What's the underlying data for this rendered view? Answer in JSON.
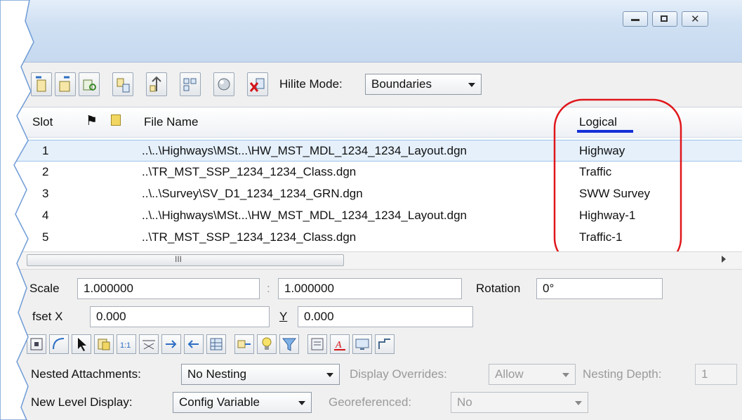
{
  "window": {
    "buttons": {
      "minimize": "minimize",
      "restore": "restore",
      "close": "close"
    }
  },
  "toolbar": {
    "icons": [
      "attach-icon",
      "detach-icon",
      "reload-icon",
      "swap-icon",
      "tree-icon",
      "grid-icon",
      "sphere-icon",
      "delete-icon"
    ],
    "hilite_label": "Hilite Mode:",
    "hilite_value": "Boundaries"
  },
  "grid": {
    "columns": {
      "slot": "Slot",
      "file_name": "File Name",
      "logical": "Logical"
    },
    "rows": [
      {
        "slot": "1",
        "file_name": "..\\..\\Highways\\MSt...\\HW_MST_MDL_1234_1234_Layout.dgn",
        "logical": "Highway"
      },
      {
        "slot": "2",
        "file_name": "..\\TR_MST_SSP_1234_1234_Class.dgn",
        "logical": "Traffic"
      },
      {
        "slot": "3",
        "file_name": "..\\..\\Survey\\SV_D1_1234_1234_GRN.dgn",
        "logical": "SWW Survey"
      },
      {
        "slot": "4",
        "file_name": "..\\..\\Highways\\MSt...\\HW_MST_MDL_1234_1234_Layout.dgn",
        "logical": "Highway-1"
      },
      {
        "slot": "5",
        "file_name": "..\\TR_MST_SSP_1234_1234_Class.dgn",
        "logical": "Traffic-1"
      }
    ],
    "scroll_grip": "III"
  },
  "props": {
    "scale_label": "Scale",
    "scale_value_1": "1.000000",
    "scale_sep": ":",
    "scale_value_2": "1.000000",
    "rotation_label": "Rotation",
    "rotation_value": "0°",
    "offset_x_label": "fset X",
    "offset_x_value": "0.000",
    "offset_y_label": "Y",
    "offset_y_value": "0.000"
  },
  "tools2": {
    "icons": [
      "fit-icon",
      "clip-icon",
      "select-icon",
      "copy-icon",
      "scale-icon",
      "frame-icon",
      "move-icon",
      "arrow-icon",
      "table-icon",
      "link-icon",
      "bulb-icon",
      "filter-icon",
      "props-icon",
      "text-color-icon",
      "monitor-icon",
      "path-icon"
    ]
  },
  "nesting": {
    "nested_label": "Nested Attachments:",
    "nested_value": "No Nesting",
    "overrides_label": "Display Overrides:",
    "overrides_value": "Allow",
    "depth_label": "Nesting Depth:",
    "depth_value": "1"
  },
  "levels": {
    "new_level_label": "New Level Display:",
    "new_level_value": "Config Variable",
    "geo_label": "Georeferenced:",
    "geo_value": "No"
  },
  "colors": {
    "annotation": "#e0161b",
    "underline": "#1530d8",
    "frame": "#c5d8ef"
  }
}
